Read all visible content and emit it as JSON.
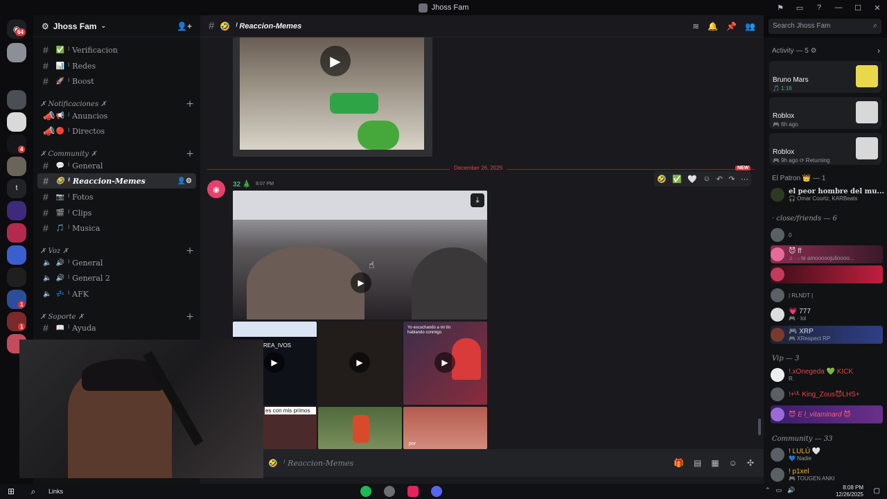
{
  "window": {
    "title": "Jhoss Fam"
  },
  "server": {
    "name": "Jhoss Fam",
    "badge_count": "64"
  },
  "guild_badges": [
    "4",
    "1",
    "1"
  ],
  "channels": [
    {
      "emoji": "✅",
      "name": "ˡ Verificacion"
    },
    {
      "emoji": "📊",
      "name": "ˡ Redes"
    },
    {
      "emoji": "🚀",
      "name": "ˡ Boost"
    }
  ],
  "categories": {
    "notificaciones": "✗ Notificaciones ✗",
    "community": "✗ Community ✗",
    "voz": "✗ Voz ✗",
    "soporte": "✗ Soporte ✗"
  },
  "notif_channels": [
    {
      "emoji": "📢",
      "name": "ˡ Anuncios"
    },
    {
      "emoji": "🔴",
      "name": "ˡ Directos"
    }
  ],
  "community_channels": [
    {
      "emoji": "💬",
      "name": "ˡ General"
    },
    {
      "emoji": "🤣",
      "name": "ˡ Reaccion-Memes"
    },
    {
      "emoji": "📷",
      "name": "ˡ Fotos"
    },
    {
      "emoji": "🎬",
      "name": "ˡ Clips"
    },
    {
      "emoji": "🎵",
      "name": "ˡ Musica"
    }
  ],
  "voice_channels": [
    {
      "emoji": "🔊",
      "name": "ˡ General"
    },
    {
      "emoji": "🔊",
      "name": "ˡ General 2"
    },
    {
      "emoji": "💤",
      "name": "ˡ AFK"
    }
  ],
  "support_channels": [
    {
      "emoji": "📖",
      "name": "ˡ Ayuda"
    }
  ],
  "chat": {
    "channel_name": "ˡ Reaccion-Memes",
    "date_divider": "December 26, 2025",
    "new_label": "NEW",
    "message": {
      "author": "32",
      "time": "8:07 PM"
    },
    "composer_placeholder": "ˡ Reaccion-Memes",
    "search_placeholder": "Search Jhoss Fam",
    "thumb_captions": [
      "REA_IVOS",
      "Yo escuchando a mi tío hablando conmigo",
      "es con mis primos",
      "por"
    ]
  },
  "members": {
    "activity_header": "Activity — 5",
    "activities": [
      {
        "game": "Bruno Mars",
        "sub": "🎵 1:16"
      },
      {
        "game": "Roblox",
        "sub": "🎮 6h ago"
      },
      {
        "game": "Roblox",
        "sub": "🎮 9h ago  ⟳ Returning"
      }
    ],
    "role_patron": "El Patron 👑 — 1",
    "patron_member": {
      "name": "el peor hombre del mu...",
      "sub": "🎧 Omar Courtz, KARBeats"
    },
    "role_close": "· close/friends — 6",
    "close_members": [
      {
        "name": "",
        "sub": "0"
      },
      {
        "name": "😈 ff",
        "sub": "♫ · 𝆕 te amooooojulioooo..."
      },
      {
        "name": "",
        "sub": ""
      },
      {
        "name": "",
        "sub": "| RLNDT |"
      },
      {
        "name": "💗 777",
        "sub": "🎮 · lol"
      },
      {
        "name": "🎮 XRP",
        "sub": "🎮 XRespect RP"
      }
    ],
    "role_vip": "Vip — 3",
    "vip_members": [
      {
        "name": "!.xOnegeda 💚 KICK",
        "sub": "R."
      },
      {
        "name": "!+ᵁᴸ King_Zous😈LHS+",
        "sub": ""
      },
      {
        "name": "😈 E l_vitaminard 😈",
        "sub": ""
      }
    ],
    "role_community": "Community — 33",
    "community_members": [
      {
        "name": "! LULÚ 🤍",
        "sub": "💙 Nadie"
      },
      {
        "name": "! p1xel",
        "sub": "🎮 TOUGEN ANKI"
      }
    ]
  },
  "taskbar": {
    "search": "Links",
    "time": "8:08 PM",
    "date": "12/26/2025"
  },
  "colors": {
    "accent": "#5865f2",
    "unread": "#da373c",
    "online": "#23a55a"
  }
}
